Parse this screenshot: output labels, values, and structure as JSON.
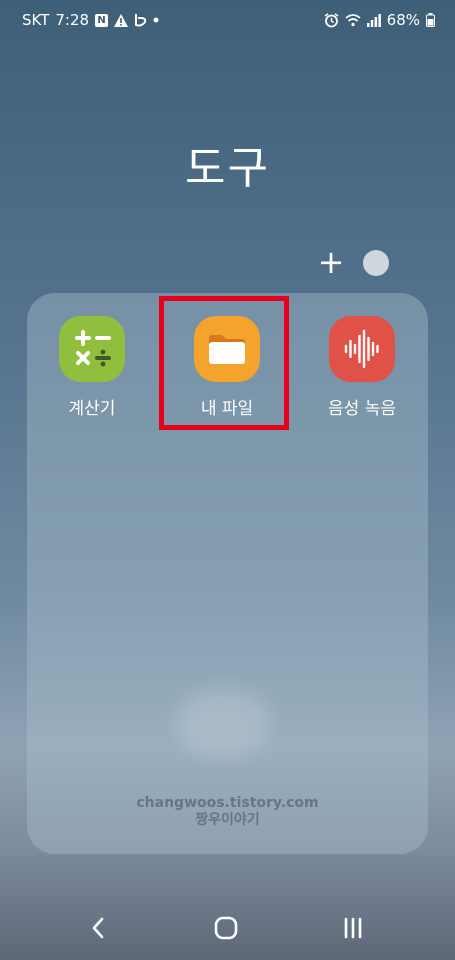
{
  "status_bar": {
    "carrier": "SKT",
    "time": "7:28",
    "notification_badge": "N",
    "battery": "68%"
  },
  "folder": {
    "title": "도구",
    "add_label": "+"
  },
  "apps": [
    {
      "label": "계산기",
      "icon": "calculator-icon",
      "color": "#8fbf3c"
    },
    {
      "label": "내 파일",
      "icon": "folder-icon",
      "color": "#f4a32c"
    },
    {
      "label": "음성 녹음",
      "icon": "voice-recorder-icon",
      "color": "#e05147"
    }
  ],
  "watermark": {
    "line1": "changwoos.tistory.com",
    "line2": "짱우이야기"
  },
  "colors": {
    "highlight": "#e6001a"
  },
  "nav": {
    "back": "back-icon",
    "home": "home-icon",
    "recents": "recents-icon"
  }
}
